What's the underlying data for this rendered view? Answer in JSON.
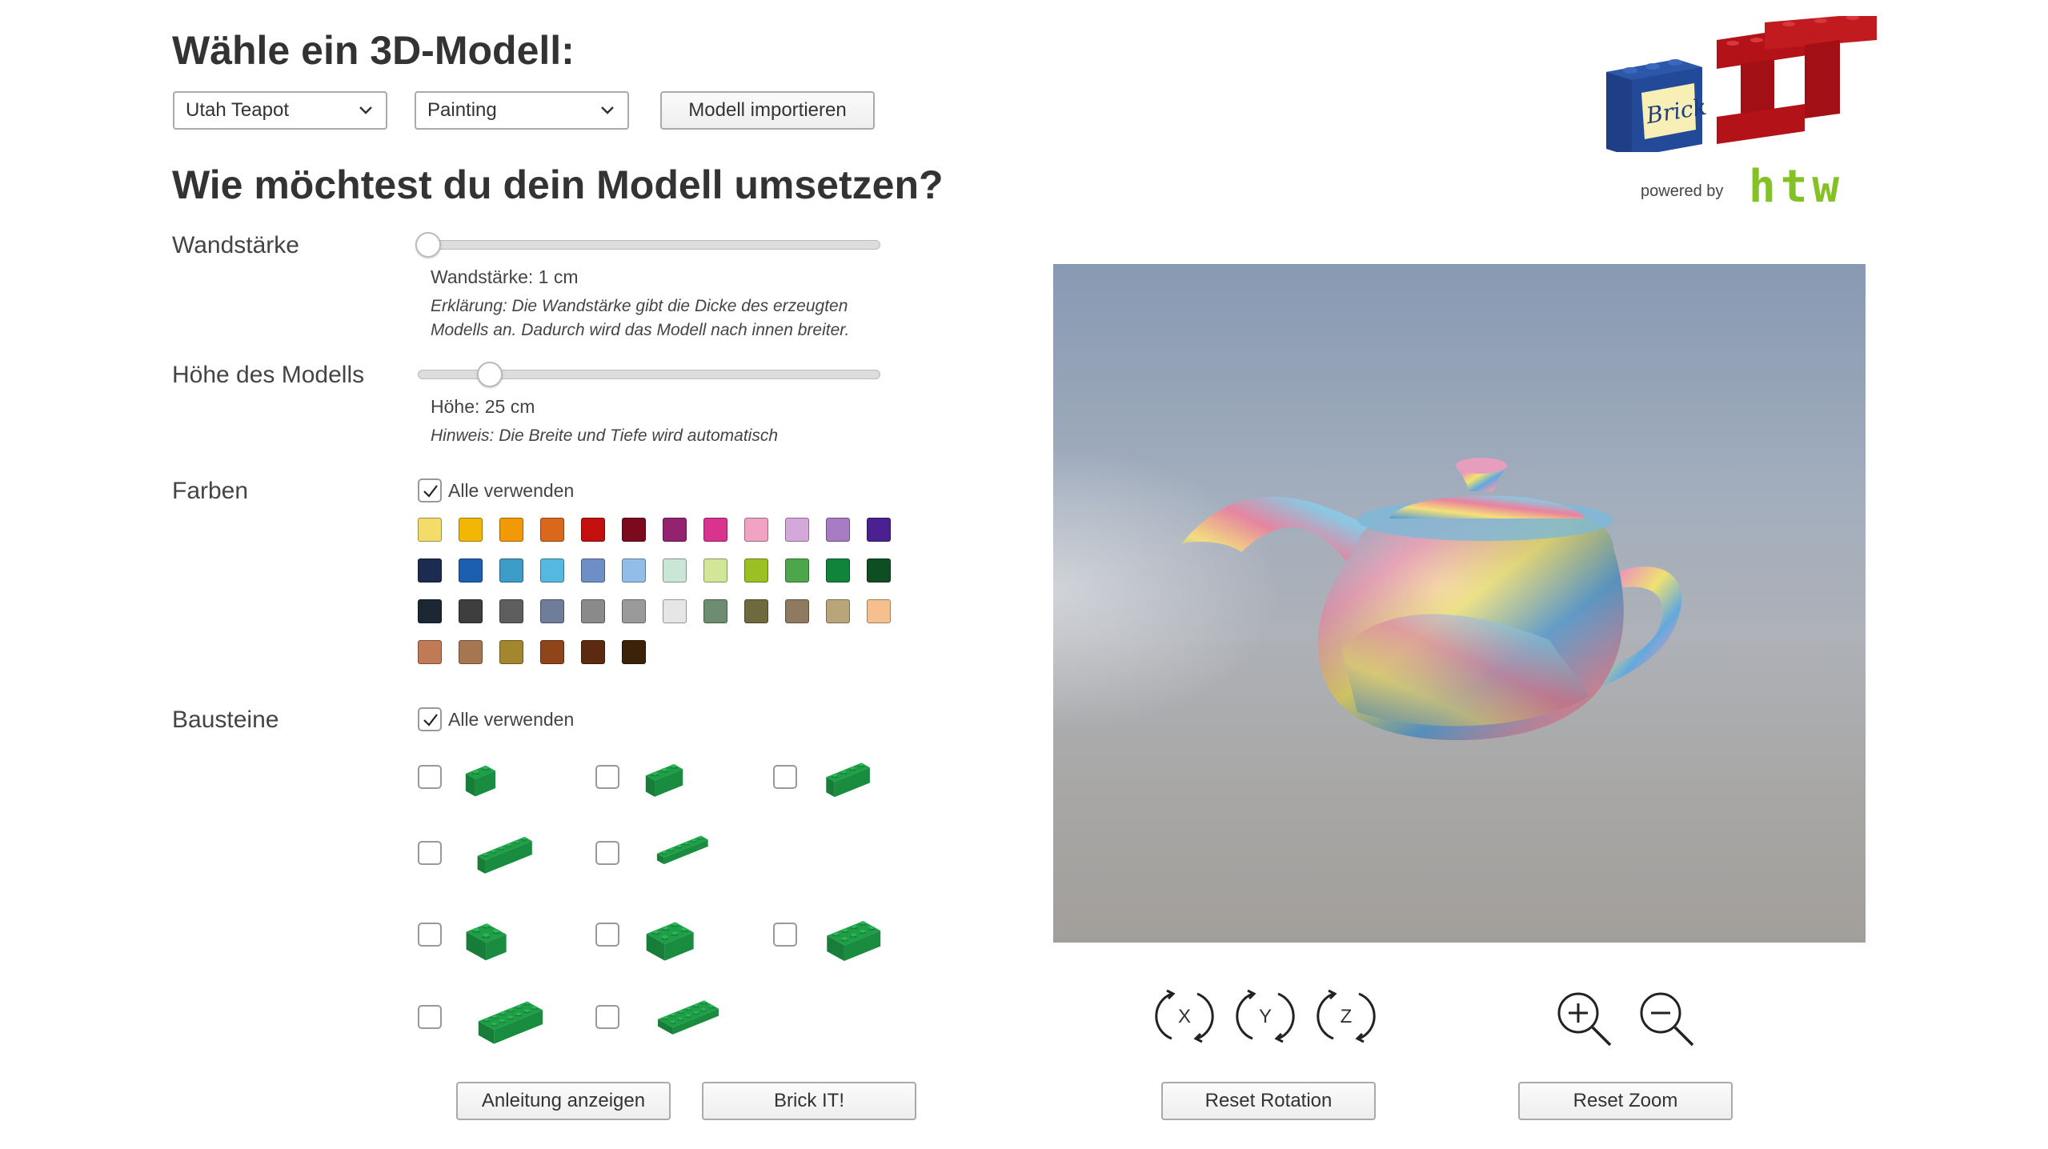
{
  "header": {
    "title": "Wähle ein 3D-Modell:",
    "model_select": "Utah Teapot",
    "texture_select": "Painting",
    "import_button": "Modell importieren"
  },
  "section2": {
    "title": "Wie möchtest du dein Modell umsetzen?"
  },
  "logo": {
    "brick_text": "Brick",
    "it_text": "IT",
    "powered_by": "powered by",
    "htw_text": "htw"
  },
  "wall": {
    "label": "Wandstärke",
    "value_text": "Wandstärke: 1 cm",
    "slider_fraction": 0.0,
    "note_line1": "Erklärung: Die Wandstärke gibt die Dicke des erzeugten",
    "note_line2": "Modells an. Dadurch wird das Modell nach innen breiter."
  },
  "height": {
    "label": "Höhe des Modells",
    "value_text": "Höhe: 25 cm",
    "slider_fraction": 0.14,
    "note": "Hinweis: Die Breite und Tiefe wird automatisch"
  },
  "colors": {
    "label": "Farben",
    "all_label": "Alle verwenden",
    "all_checked": true,
    "swatches": [
      [
        "#f4dc6b",
        "#f2b705",
        "#f29a05",
        "#d9681c",
        "#c40f0f",
        "#7b0a1c",
        "#93226f",
        "#d9338f",
        "#f0a3c3",
        "#d5a8dc",
        "#a77cc4",
        "#4b2191"
      ],
      [
        "#1c2b4f",
        "#1c5eb0",
        "#3d9bc7",
        "#55b8de",
        "#6e8fc6",
        "#92bde9",
        "#c9e6d7",
        "#d1e697",
        "#9ac022",
        "#4ea64a",
        "#11843c",
        "#0e4e22"
      ],
      [
        "#1b2733",
        "#3e3e3e",
        "#5e5e5e",
        "#6f7d9b",
        "#8a8a8a",
        "#9a9a9a",
        "#e6e6e6",
        "#6e8c72",
        "#6f6a3e",
        "#8e7a5e",
        "#b8a579",
        "#f6c08e"
      ],
      [
        "#c07a55",
        "#a57650",
        "#a3862e",
        "#8f4519",
        "#5c2a0e",
        "#3b2208"
      ]
    ]
  },
  "bricks": {
    "label": "Bausteine",
    "all_label": "Alle verwenden",
    "all_checked": true,
    "color": "#1f9e47"
  },
  "buttons": {
    "instructions": "Anleitung anzeigen",
    "brick_it": "Brick IT!",
    "reset_rotation": "Reset Rotation",
    "reset_zoom": "Reset Zoom"
  },
  "controls": {
    "rot_x": "X",
    "rot_y": "Y",
    "rot_z": "Z"
  }
}
